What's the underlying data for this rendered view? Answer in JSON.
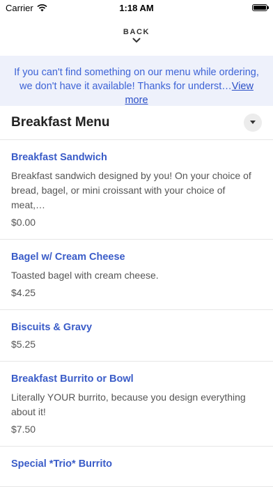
{
  "status": {
    "carrier": "Carrier",
    "time": "1:18 AM"
  },
  "nav": {
    "back_label": "BACK"
  },
  "notice": {
    "text": "If you can't find something on our menu while ordering, we don't have it available! Thanks for underst…",
    "link": "View more"
  },
  "menu": {
    "title": "Breakfast Menu",
    "items": [
      {
        "name": "Breakfast Sandwich",
        "description": "Breakfast sandwich designed by you!  On your choice of bread, bagel, or mini croissant with your choice of meat,…",
        "price": "$0.00"
      },
      {
        "name": "Bagel w/ Cream Cheese",
        "description": "Toasted bagel with cream cheese.",
        "price": "$4.25"
      },
      {
        "name": "Biscuits & Gravy",
        "description": "",
        "price": "$5.25"
      },
      {
        "name": "Breakfast Burrito or Bowl",
        "description": "Literally YOUR burrito, because you design everything about it!",
        "price": "$7.50"
      },
      {
        "name": "Special *Trio* Burrito",
        "description": "",
        "price": ""
      }
    ]
  },
  "colors": {
    "accent": "#3a5cc8",
    "notice_bg": "#eef1fb",
    "notice_text": "#3d63d6"
  }
}
